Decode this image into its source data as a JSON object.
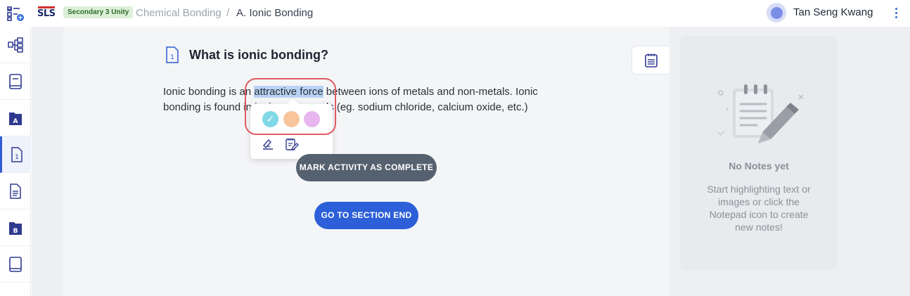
{
  "header": {
    "logo_text": "SLS",
    "class_badge": "Secondary 3 Unity",
    "breadcrumb": [
      "Chemical Bonding",
      "A. Ionic Bonding"
    ],
    "breadcrumb_separator": "/",
    "user_name": "Tan Seng Kwang"
  },
  "sidebar": {
    "items": [
      {
        "icon": "lesson-map-icon"
      },
      {
        "icon": "book-icon"
      },
      {
        "icon": "section-a-icon",
        "label": "A"
      },
      {
        "icon": "activity-1-icon",
        "label": "1",
        "active": true
      },
      {
        "icon": "document-icon"
      },
      {
        "icon": "section-b-icon",
        "label": "B"
      },
      {
        "icon": "book-end-icon"
      }
    ]
  },
  "activity": {
    "number": "1",
    "title": "What is ionic bonding?",
    "text_before": "Ionic bonding is an ",
    "highlighted_text": "attractive force",
    "text_after": " between ions of metals and non-metals. Ionic bonding is found in ionic compounds (eg. sodium chloride, calcium oxide, etc.)"
  },
  "highlight_popover": {
    "colors": [
      "#7fd8e6",
      "#f8c49c",
      "#e8b5ee"
    ],
    "selected_index": 0,
    "actions": [
      "annotate-icon",
      "add-to-notes-icon"
    ]
  },
  "buttons": {
    "mark_complete": "MARK ACTIVITY AS COMPLETE",
    "section_end": "GO TO SECTION END"
  },
  "notes": {
    "empty_title": "No Notes yet",
    "empty_desc": "Start highlighting text or images or click the Notepad icon to create new notes!"
  },
  "colors": {
    "accent_blue": "#2c5fd8",
    "button_grey": "#566170",
    "highlight": "#b9d3f4",
    "focus_ring": "#e05b62"
  }
}
